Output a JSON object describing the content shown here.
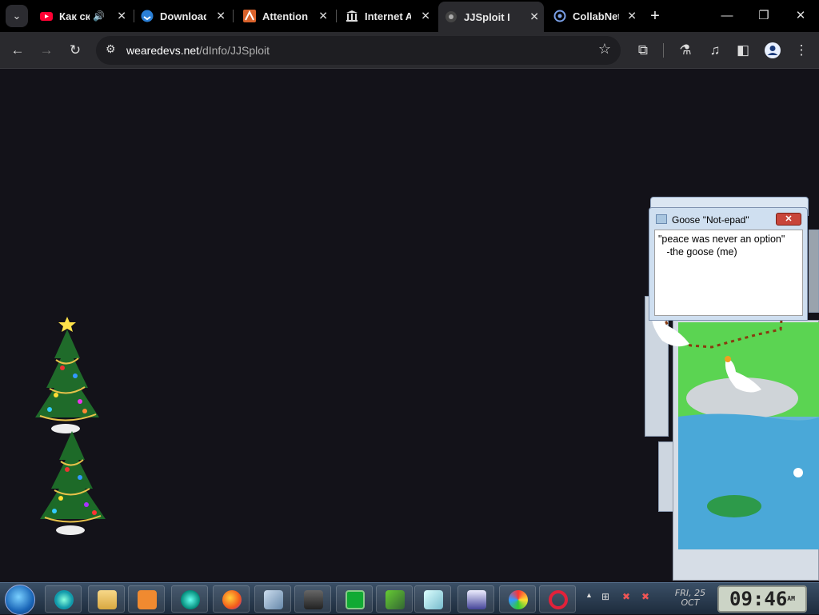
{
  "tabs": [
    {
      "label": "Как ск",
      "favicon": "youtube-icon",
      "audio": "🔊"
    },
    {
      "label": "Download",
      "favicon": "download-site-icon"
    },
    {
      "label": "Attention",
      "favicon": "attention-site-icon"
    },
    {
      "label": "Internet A",
      "favicon": "archive-icon"
    },
    {
      "label": "JJSploit In",
      "favicon": "jjsploit-icon"
    },
    {
      "label": "CollabNet",
      "favicon": "collabnet-icon"
    }
  ],
  "tab_close": "✕",
  "new_tab": "+",
  "window_controls": {
    "minimize": "—",
    "restore": "❐",
    "close": "✕"
  },
  "address": {
    "domain": "wearedevs.net",
    "path": "/dInfo/JJSploit"
  },
  "notepad": {
    "title": "Goose \"Not-epad\"",
    "close": "✕",
    "text": "\"peace was never an option\"\n   -the goose (me)"
  },
  "taskbar": {
    "date": "FRI, 25",
    "month": "OCT",
    "time": "09:46",
    "ampm": "AM",
    "icons": [
      "internet-explorer-icon",
      "folder-icon",
      "media-player-icon",
      "teal-orb-icon",
      "firefox-icon",
      "control-panel-icon",
      "film-icon",
      "terminal-icon",
      "arrow-app-icon",
      "paper-icon",
      "scanner-icon",
      "paint-icon",
      "opera-icon"
    ]
  },
  "colors": {
    "accent": "#131219",
    "tabbar": "#000000",
    "toolbar": "#2a2a2e"
  }
}
